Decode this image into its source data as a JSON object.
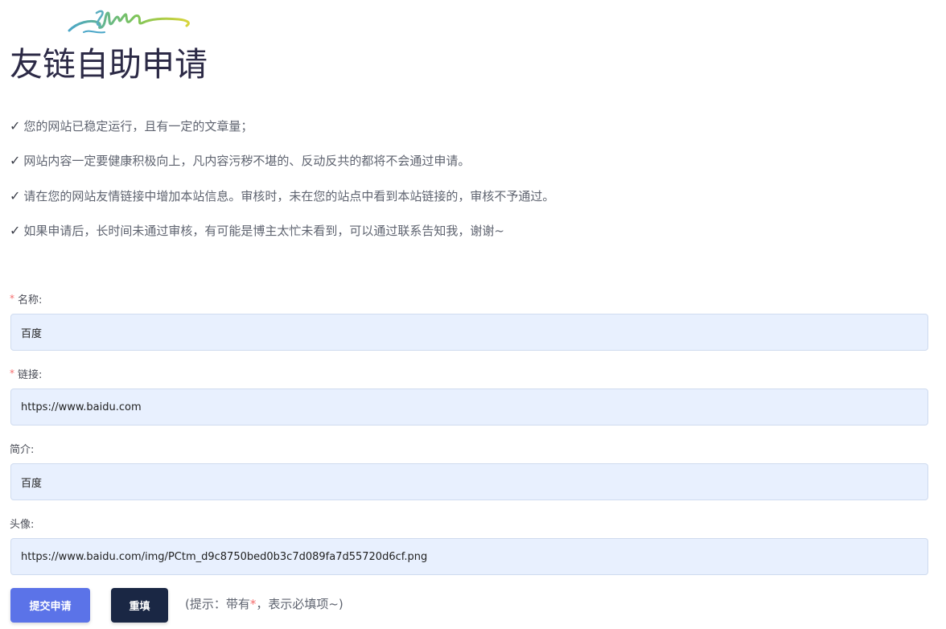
{
  "header": {
    "title": "友链自助申请"
  },
  "rules": [
    "您的网站已稳定运行，且有一定的文章量；",
    "网站内容一定要健康积极向上，凡内容污秽不堪的、反动反共的都将不会通过申请。",
    "请在您的网站友情链接中增加本站信息。审核时，未在您的站点中看到本站链接的，审核不予通过。",
    "如果申请后，长时间未通过审核，有可能是博主太忙未看到，可以通过联系告知我，谢谢~"
  ],
  "rule_icon": "check-icon",
  "form": {
    "required_mark": "*",
    "name": {
      "label": "名称:",
      "value": "百度"
    },
    "link": {
      "label": "链接:",
      "value": "https://www.baidu.com"
    },
    "intro": {
      "label": "简介:",
      "value": "百度"
    },
    "avatar": {
      "label": "头像:",
      "value": "https://www.baidu.com/img/PCtm_d9c8750bed0b3c7d089fa7d55720d6cf.png"
    }
  },
  "actions": {
    "submit_label": "提交申请",
    "reset_label": "重填",
    "hint_prefix": "(提示：带有",
    "hint_star": "*",
    "hint_suffix": "，表示必填项~)"
  },
  "colors": {
    "submit": "#5b73e8",
    "reset": "#1a2744",
    "input_bg": "#e8f0fe",
    "required": "#f56c6c"
  }
}
